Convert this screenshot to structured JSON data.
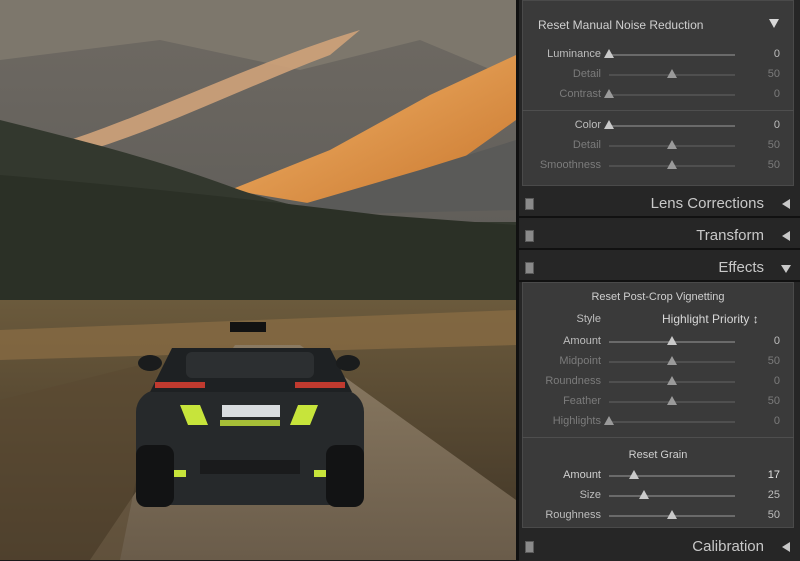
{
  "noise": {
    "header": "Reset Manual Noise Reduction",
    "rows": [
      {
        "label": "Luminance",
        "value": "0",
        "pos": 0.0,
        "state": "on"
      },
      {
        "label": "Detail",
        "value": "50",
        "pos": 0.5,
        "state": "dim"
      },
      {
        "label": "Contrast",
        "value": "0",
        "pos": 0.0,
        "state": "dim"
      },
      {
        "label": "Color",
        "value": "0",
        "pos": 0.0,
        "state": "on"
      },
      {
        "label": "Detail",
        "value": "50",
        "pos": 0.5,
        "state": "dim"
      },
      {
        "label": "Smoothness",
        "value": "50",
        "pos": 0.5,
        "state": "dim"
      }
    ]
  },
  "panels": {
    "lens": "Lens Corrections",
    "transform": "Transform",
    "effects": "Effects",
    "calibration": "Calibration"
  },
  "vignette": {
    "header": "Reset Post-Crop Vignetting",
    "style_label": "Style",
    "style_value": "Highlight Priority ↕",
    "rows": [
      {
        "label": "Amount",
        "value": "0",
        "pos": 0.5,
        "state": "on"
      },
      {
        "label": "Midpoint",
        "value": "50",
        "pos": 0.5,
        "state": "dim"
      },
      {
        "label": "Roundness",
        "value": "0",
        "pos": 0.5,
        "state": "dim"
      },
      {
        "label": "Feather",
        "value": "50",
        "pos": 0.5,
        "state": "dim"
      },
      {
        "label": "Highlights",
        "value": "0",
        "pos": 0.0,
        "state": "dim"
      }
    ]
  },
  "grain": {
    "header": "Reset Grain",
    "rows": [
      {
        "label": "Amount",
        "value": "17",
        "pos": 0.2,
        "state": "bright"
      },
      {
        "label": "Size",
        "value": "25",
        "pos": 0.28,
        "state": "on"
      },
      {
        "label": "Roughness",
        "value": "50",
        "pos": 0.5,
        "state": "on"
      }
    ]
  },
  "icons": {
    "collapse": "triangle-left-icon",
    "expand": "triangle-down-icon",
    "toggle": "panel-switch-icon"
  }
}
